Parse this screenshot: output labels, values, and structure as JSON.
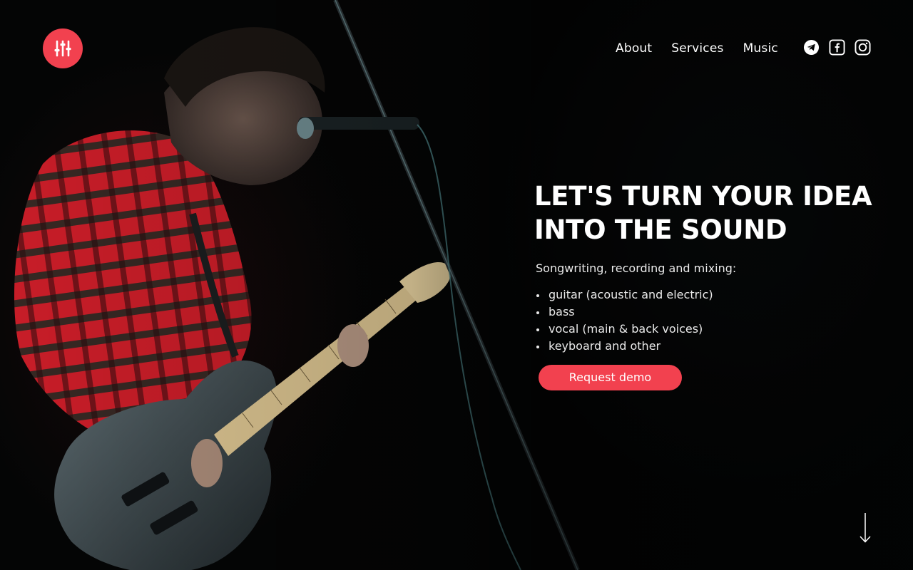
{
  "brand": {
    "logo_icon": "mixer-sliders-icon",
    "accent": "#f2414f"
  },
  "nav": {
    "items": [
      {
        "label": "About"
      },
      {
        "label": "Services"
      },
      {
        "label": "Music"
      }
    ]
  },
  "social": [
    "telegram-icon",
    "facebook-icon",
    "instagram-icon"
  ],
  "hero": {
    "headline_line1": "LET'S TURN YOUR IDEA",
    "headline_line2": "INTO THE SOUND",
    "lead": "Songwriting, recording and mixing:",
    "services": [
      "guitar (acoustic and electric)",
      "bass",
      "vocal (main & back voices)",
      "keyboard and other"
    ],
    "cta_label": "Request demo"
  },
  "background_image": "guitarist-on-stage-photo"
}
